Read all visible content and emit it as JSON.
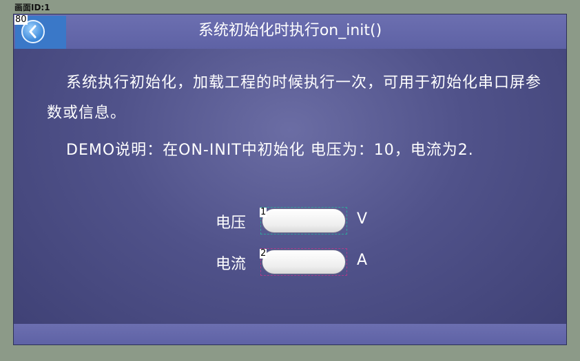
{
  "page_id_label": "画面ID:1",
  "header": {
    "back_widget_id": "80",
    "title": "系统初始化时执行on_init()"
  },
  "content": {
    "paragraph1": "系统执行初始化，加载工程的时候执行一次，可用于初始化串口屏参数或信息。",
    "paragraph2": "DEMO说明：在ON-INIT中初始化 电压为：10，电流为2."
  },
  "fields": [
    {
      "label": "电压",
      "widget_id": "1",
      "value": "",
      "unit": "V"
    },
    {
      "label": "电流",
      "widget_id": "2",
      "value": "",
      "unit": "A"
    }
  ],
  "icons": {
    "back": "chevron-left-icon"
  },
  "colors": {
    "outer_background": "#8c9a88",
    "titlebar": "#6366aa",
    "screen_background": "#50528a",
    "back_button": "#3a78c8"
  }
}
